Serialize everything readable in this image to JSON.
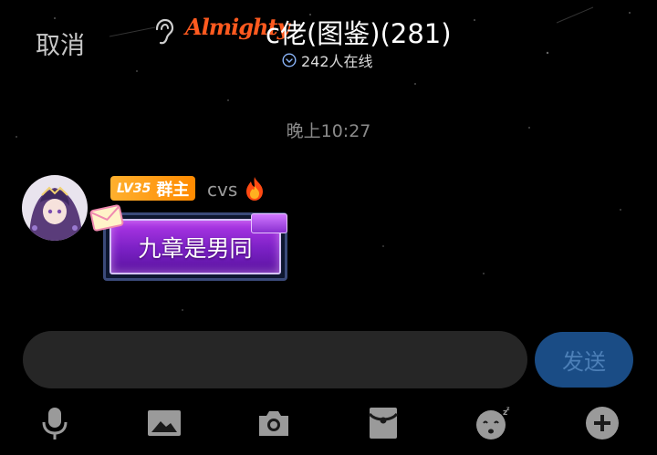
{
  "header": {
    "cancel_label": "取消",
    "logo_text": "Almighty",
    "title": "c佬(图鉴)(281)",
    "online_text": "242人在线"
  },
  "chat": {
    "timestamp": "晚上10:27",
    "message": {
      "level": "LV35",
      "role": "群主",
      "username": "cvs",
      "text": "九章是男同"
    }
  },
  "composer": {
    "input_value": "",
    "send_label": "发送"
  },
  "toolbar": {
    "icons": [
      "microphone-icon",
      "image-icon",
      "camera-icon",
      "red-packet-icon",
      "emoji-icon",
      "plus-icon"
    ]
  },
  "colors": {
    "background": "#000000",
    "badge": "#ff9a1a",
    "send_button": "#1a4c85",
    "bubble": "#8a2fd0",
    "logo": "#ff5a1f"
  }
}
